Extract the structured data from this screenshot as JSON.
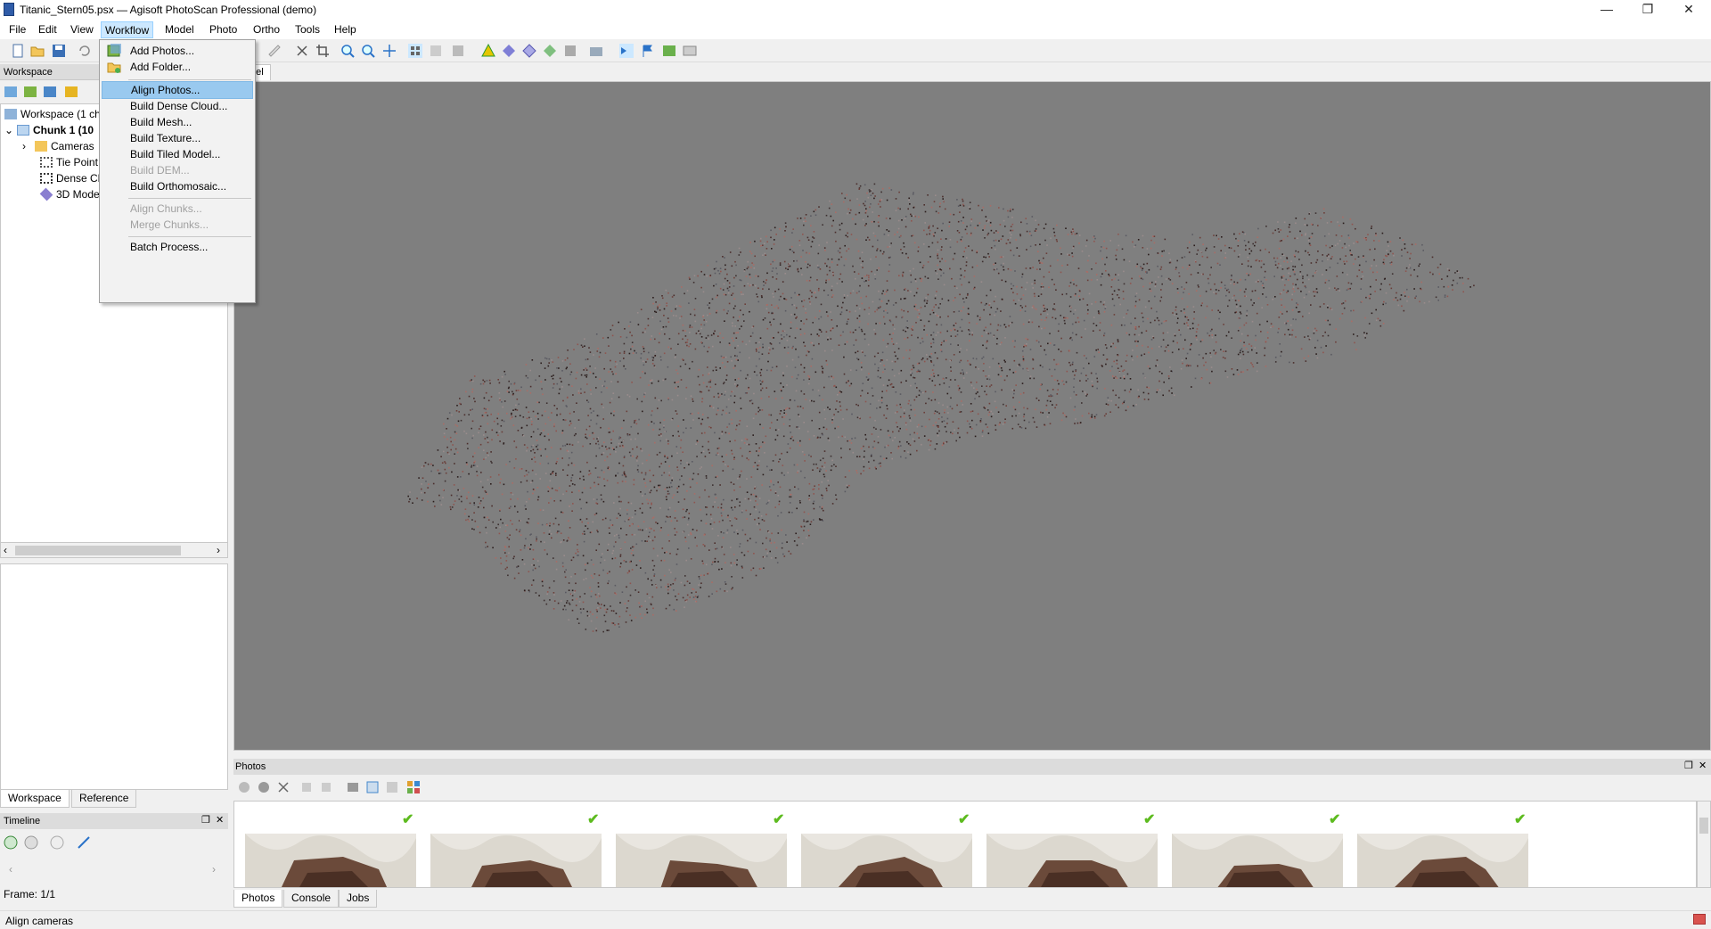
{
  "window": {
    "title": "Titanic_Stern05.psx — Agisoft PhotoScan Professional (demo)",
    "controls": [
      "—",
      "❐",
      "✕"
    ]
  },
  "menubar": [
    "File",
    "Edit",
    "View",
    "Workflow",
    "Model",
    "Photo",
    "Ortho",
    "Tools",
    "Help"
  ],
  "workflow_menu": {
    "items": [
      {
        "label": "Add Photos...",
        "enabled": true
      },
      {
        "label": "Add Folder...",
        "enabled": true
      },
      {
        "label": "Align Photos...",
        "enabled": true,
        "highlighted": true
      },
      {
        "label": "Build Dense Cloud...",
        "enabled": true
      },
      {
        "label": "Build Mesh...",
        "enabled": true
      },
      {
        "label": "Build Texture...",
        "enabled": true
      },
      {
        "label": "Build Tiled Model...",
        "enabled": true
      },
      {
        "label": "Build DEM...",
        "enabled": false
      },
      {
        "label": "Build Orthomosaic...",
        "enabled": true
      },
      {
        "label": "Align Chunks...",
        "enabled": false
      },
      {
        "label": "Merge Chunks...",
        "enabled": false
      },
      {
        "label": "Batch Process...",
        "enabled": true
      }
    ]
  },
  "workspace": {
    "header": "Workspace",
    "tree": [
      "Workspace (1 ch",
      "Chunk 1 (10",
      "Cameras",
      "Tie Point",
      "Dense Cl",
      "3D Mode"
    ],
    "tabs": [
      "Workspace",
      "Reference"
    ]
  },
  "model_tab": "del",
  "timeline": {
    "header": "Timeline",
    "frame": "Frame: 1/1"
  },
  "photos_pane": {
    "header": "Photos",
    "thumbnail_count": 7,
    "tabs": [
      "Photos",
      "Console",
      "Jobs"
    ]
  },
  "status_bar": "Align cameras",
  "colors": {
    "viewport_bg": "#7f7f7f",
    "menu_highlight": "#99c9ef",
    "check_green": "#5dbb1f"
  }
}
